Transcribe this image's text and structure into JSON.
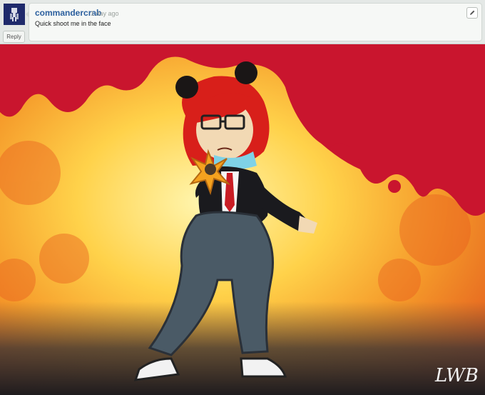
{
  "comment": {
    "username": "commandercrab",
    "timestamp": "1 day ago",
    "text": "Quick shoot me in the face",
    "reply_label": "Reply",
    "edit_icon": "pencil-icon"
  },
  "artwork": {
    "signature": "LWB",
    "colors": {
      "background_center": "#fff3a0",
      "background_edge": "#e8521e",
      "drip": "#c9152e",
      "pants": "#4a5a66",
      "hair": "#d81f1a"
    }
  }
}
